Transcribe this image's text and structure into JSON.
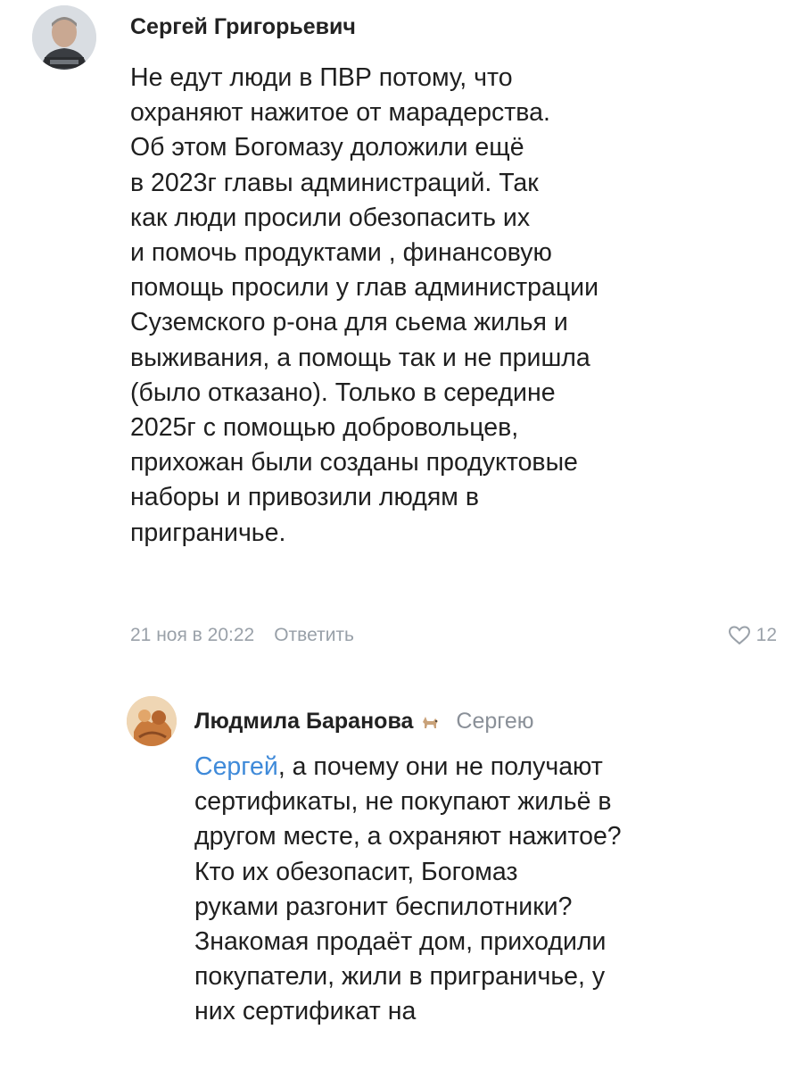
{
  "comments": [
    {
      "author": "Сергей Григорьевич",
      "lines": [
        "Не едут люди в ПВР потому, что",
        "охраняют нажитое от марадерства.",
        "Об этом Богомазу доложили ещё",
        "в 2023г главы администраций. Так",
        "как люди просили обезопасить их",
        "и помочь продуктами , финансовую",
        "помощь просили у глав администрации",
        "Суземского р-она для сьема жилья и",
        "выживания, а помощь так и не пришла",
        "(было отказано). Только в  середине",
        "2025г с помощью добровольцев,",
        "прихожан были созданы продуктовые",
        "наборы и привозили людям в",
        "приграничье."
      ],
      "timestamp": "21 ноя в 20:22",
      "reply_label": "Ответить",
      "likes": "12",
      "avatar_icon": "user-photo"
    },
    {
      "author": "Людмила Баранова",
      "author_badge_icon": "dog-emoji-icon",
      "reply_to": "Сергею",
      "mention": "Сергей",
      "first_line_rest": ", а почему они не получают",
      "lines": [
        "сертификаты, не покупают жильё в",
        "другом месте, а охраняют нажитое?",
        "Кто их обезопасит, Богомаз",
        "руками разгонит беспилотники?",
        "Знакомая продаёт дом, приходили",
        "покупатели, жили в приграничье, у",
        "них сертификат на"
      ],
      "avatar_icon": "user-photo"
    }
  ],
  "colors": {
    "mention": "#3f8ad9",
    "meta": "#9aa1a9",
    "text": "#1f1f1f"
  }
}
